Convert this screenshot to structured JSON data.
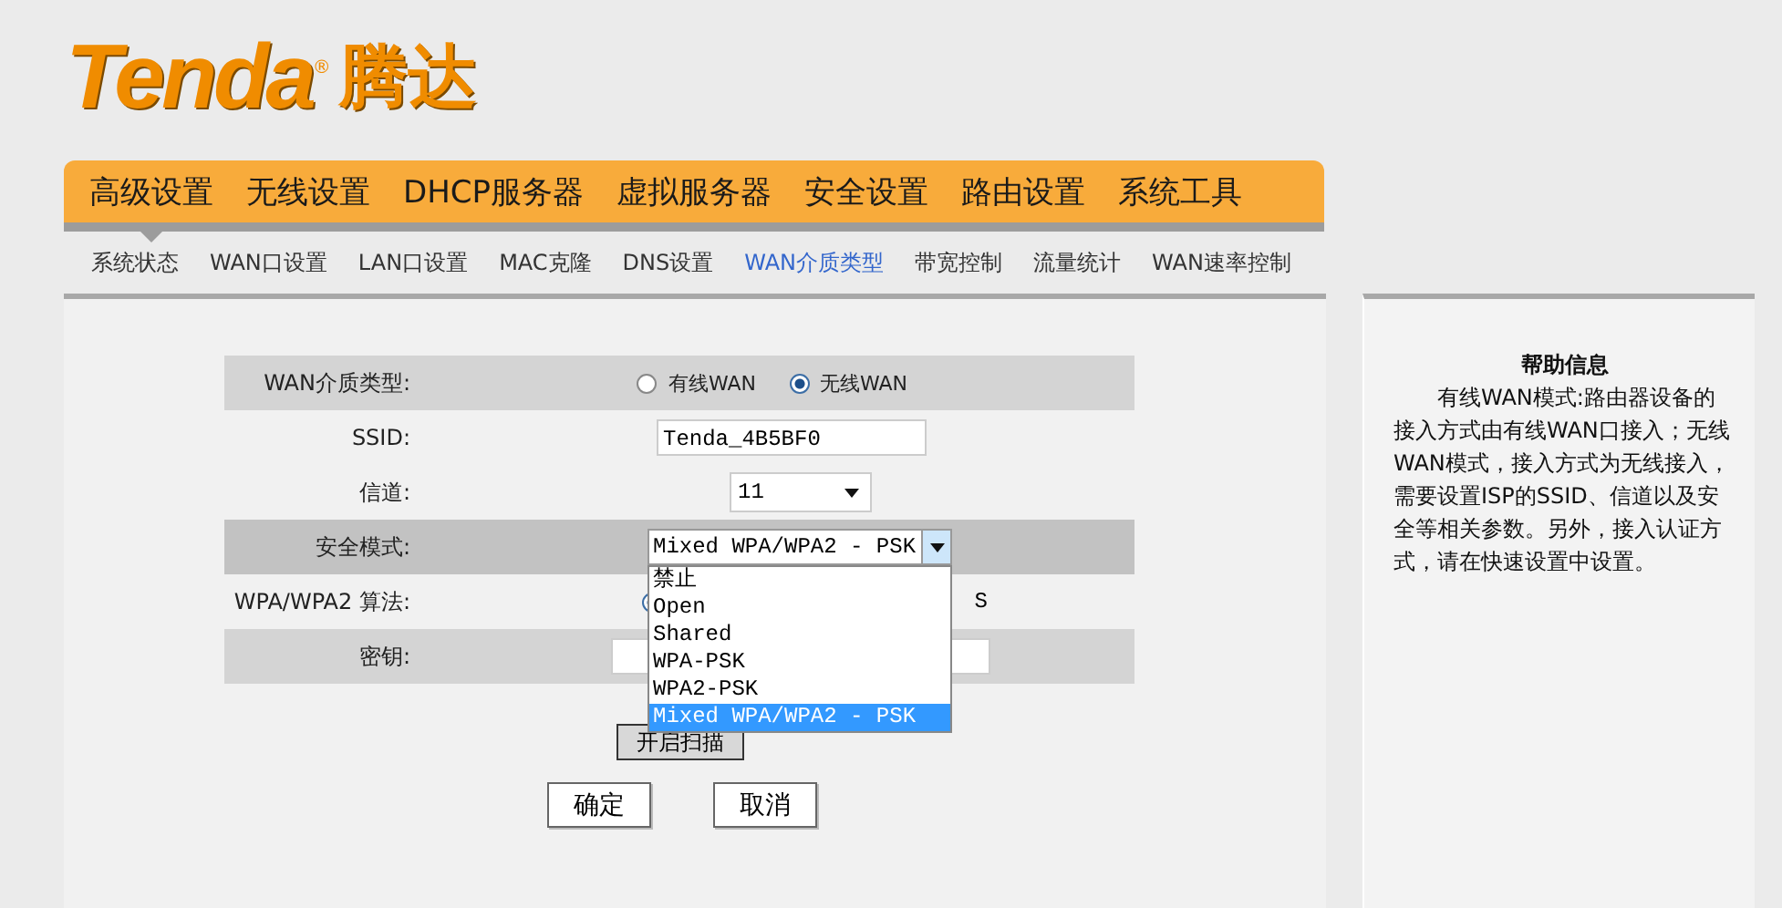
{
  "logo": {
    "brand": "Tenda",
    "mark": "®",
    "name": "腾达"
  },
  "nav": {
    "tabs": [
      {
        "label": "高级设置",
        "selected": true
      },
      {
        "label": "无线设置",
        "selected": false
      },
      {
        "label": "DHCP服务器",
        "selected": false
      },
      {
        "label": "虚拟服务器",
        "selected": false
      },
      {
        "label": "安全设置",
        "selected": false
      },
      {
        "label": "路由设置",
        "selected": false
      },
      {
        "label": "系统工具",
        "selected": false
      }
    ]
  },
  "subnav": {
    "tabs": [
      {
        "label": "系统状态",
        "selected": false
      },
      {
        "label": "WAN口设置",
        "selected": false
      },
      {
        "label": "LAN口设置",
        "selected": false
      },
      {
        "label": "MAC克隆",
        "selected": false
      },
      {
        "label": "DNS设置",
        "selected": false
      },
      {
        "label": "WAN介质类型",
        "selected": true
      },
      {
        "label": "带宽控制",
        "selected": false
      },
      {
        "label": "流量统计",
        "selected": false
      },
      {
        "label": "WAN速率控制",
        "selected": false
      }
    ]
  },
  "form": {
    "rows": [
      {
        "kind": "radio",
        "shaded": true,
        "label": "WAN介质类型:",
        "options": [
          {
            "label": "有线WAN",
            "selected": false
          },
          {
            "label": "无线WAN",
            "selected": true
          }
        ]
      },
      {
        "kind": "text",
        "label": "SSID:",
        "value": "Tenda_4B5BF0"
      },
      {
        "kind": "select",
        "label": "信道:",
        "value": "11"
      },
      {
        "kind": "dropdown",
        "shaded": true,
        "focused": true,
        "label": "安全模式:",
        "value": "Mixed WPA/WPA2 - PSK",
        "expanded": true,
        "options": [
          {
            "label": "禁止",
            "selected": false
          },
          {
            "label": "Open",
            "selected": false
          },
          {
            "label": "Shared",
            "selected": false
          },
          {
            "label": "WPA-PSK",
            "selected": false
          },
          {
            "label": "WPA2-PSK",
            "selected": false
          },
          {
            "label": "Mixed WPA/WPA2 - PSK",
            "selected": true
          }
        ]
      },
      {
        "kind": "covered-radio",
        "label": "WPA/WPA2 算法:",
        "selected": true,
        "tail": "S"
      },
      {
        "kind": "password",
        "shaded": true,
        "label": "密钥:"
      }
    ],
    "scan_button": "开启扫描",
    "buttons": [
      "确定",
      "取消"
    ]
  },
  "help": {
    "title": "帮助信息",
    "text": "有线WAN模式:路由器设备的接入方式由有线WAN口接入；无线WAN模式，接入方式为无线接入，需要设置ISP的SSID、信道以及安全等相关参数。另外，接入认证方式，请在快速设置中设置。"
  }
}
